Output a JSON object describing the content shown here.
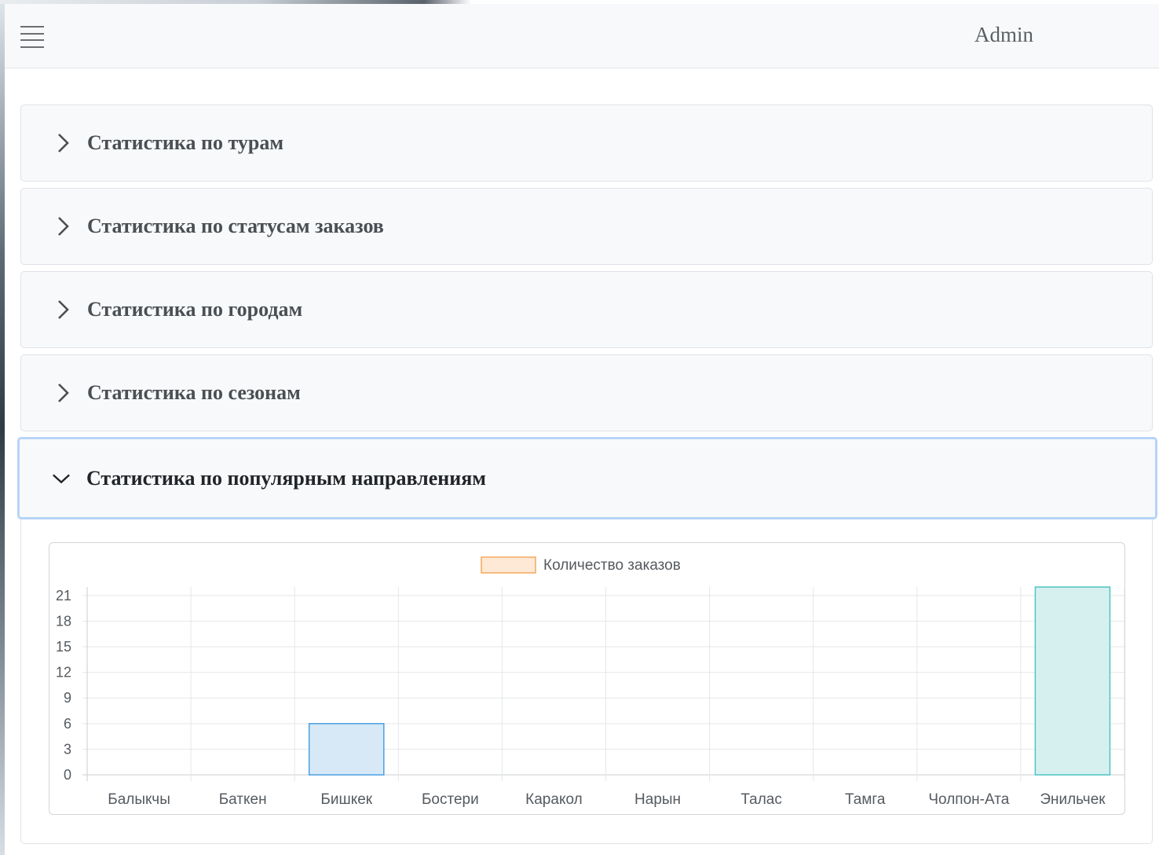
{
  "navbar": {
    "menu_icon": "hamburger-icon",
    "user_label": "Admin"
  },
  "accordion": {
    "items": [
      {
        "title": "Статистика по турам",
        "expanded": false
      },
      {
        "title": "Статистика по статусам заказов",
        "expanded": false
      },
      {
        "title": "Статистика по городам",
        "expanded": false
      },
      {
        "title": "Статистика по сезонам",
        "expanded": false
      },
      {
        "title": "Статистика по популярным направлениям",
        "expanded": true
      }
    ],
    "collapsed_icon": "chevron-right-icon",
    "expanded_icon": "chevron-down-icon"
  },
  "chart_data": {
    "type": "bar",
    "categories": [
      "Балыкчы",
      "Баткен",
      "Бишкек",
      "Бостери",
      "Каракол",
      "Нарын",
      "Талас",
      "Тамга",
      "Чолпон-Ата",
      "Энильчек"
    ],
    "series": [
      {
        "name": "Количество заказов",
        "values": [
          0,
          0,
          6,
          0,
          0,
          0,
          0,
          0,
          0,
          22
        ]
      }
    ],
    "ylim": [
      0,
      22
    ],
    "yticks": [
      0,
      3,
      6,
      9,
      12,
      15,
      18,
      21
    ],
    "grid": true,
    "legend_position": "top",
    "legend_color": {
      "fill": "#fde9d6",
      "stroke": "#f3a95c"
    },
    "bar_colors": {
      "default": {
        "fill": "#ffffff",
        "stroke": "#cccccc"
      },
      "Бишкек": {
        "fill": "#d7e9f7",
        "stroke": "#4a9fe0"
      },
      "Энильчек": {
        "fill": "#d6f0f0",
        "stroke": "#4fc3c3"
      }
    }
  }
}
